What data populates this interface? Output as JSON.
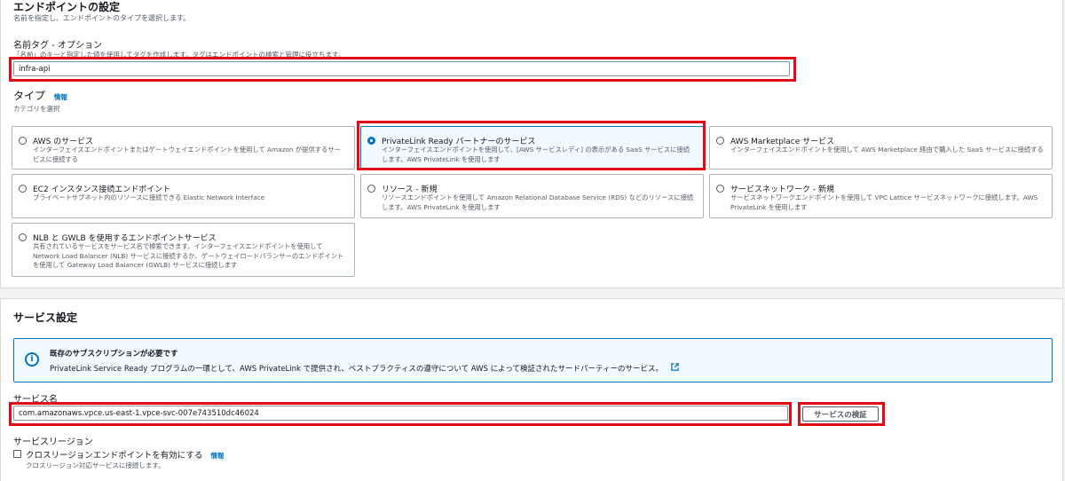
{
  "endpoint": {
    "title": "エンドポイントの設定",
    "description": "名前を指定し、エンドポイントのタイプを選択します。",
    "name_tag": {
      "label": "名前タグ - オプション",
      "hint": "「名前」のキーと指定した値を使用してタグを作成します。タグはエンドポイントの検索と管理に役立ちます。",
      "value": "infra-api"
    },
    "type": {
      "label": "タイプ",
      "info": "情報",
      "hint": "カテゴリを選択",
      "options": [
        {
          "title": "AWS のサービス",
          "desc": "インターフェイスエンドポイントまたはゲートウェイエンドポイントを使用して Amazon が提供するサービスに接続する",
          "selected": false
        },
        {
          "title": "PrivateLink Ready パートナーのサービス",
          "desc": "インターフェイスエンドポイントを使用して、[AWS サービスレディ] の表示がある SaaS サービスに接続します。AWS PrivateLink を使用します",
          "selected": true
        },
        {
          "title": "AWS Marketplace サービス",
          "desc": "インターフェイスエンドポイントを使用して AWS Marketplace 経由で購入した SaaS サービスに接続する",
          "selected": false
        },
        {
          "title": "EC2 インスタンス接続エンドポイント",
          "desc": "プライベートサブネット内のリソースに接続できる Elastic Network Interface",
          "selected": false
        },
        {
          "title": "リソース - 新規",
          "desc": "リソースエンドポイントを使用して Amazon Relational Database Service (RDS) などのリソースに接続します。AWS PrivateLink を使用します",
          "selected": false
        },
        {
          "title": "サービスネットワーク - 新規",
          "desc": "サービスネットワークエンドポイントを使用して VPC Lattice サービスネットワークに接続します。AWS PrivateLink を使用します",
          "selected": false
        },
        {
          "title": "NLB と GWLB を使用するエンドポイントサービス",
          "desc": "共有されているサービスをサービス名で検索できます。インターフェイスエンドポイントを使用して Network Load Balancer (NLB) サービスに接続するか、ゲートウェイロードバランサーのエンドポイントを使用して Gateway Load Balancer (GWLB) サービスに接続します",
          "selected": false
        }
      ]
    }
  },
  "service": {
    "title": "サービス設定",
    "alert": {
      "title": "既存のサブスクリプションが必要です",
      "body": "PrivateLink Service Ready プログラムの一環として、AWS PrivateLink で提供され、ベストプラクティスの遵守について AWS によって検証されたサードパーティーのサービス。",
      "link_icon": "external-link-icon"
    },
    "service_name": {
      "label": "サービス名",
      "value": "com.amazonaws.vpce.us-east-1.vpce-svc-007e743510dc46024",
      "verify_label": "サービスの検証"
    },
    "cross_region": {
      "label": "サービスリージョン",
      "checkbox_label": "クロスリージョンエンドポイントを有効にする",
      "info": "情報",
      "hint": "クロスリージョン対応サービスに接続します。",
      "checked": false
    }
  },
  "colors": {
    "accent": "#0073bb",
    "highlight": "#e00b15",
    "text": "#16191f",
    "muted": "#545b64"
  }
}
